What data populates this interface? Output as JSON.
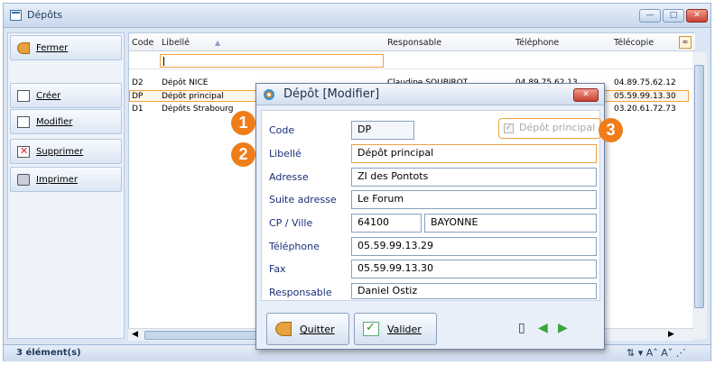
{
  "window": {
    "title": "Dépôts",
    "minimize": "—",
    "maximize": "□",
    "close": "✕"
  },
  "sidebar": {
    "items": [
      {
        "label": "Fermer",
        "icon": "exit-door-icon"
      },
      {
        "label": "Créer",
        "icon": "new-document-icon"
      },
      {
        "label": "Modifier",
        "icon": "edit-document-icon"
      },
      {
        "label": "Supprimer",
        "icon": "delete-icon"
      },
      {
        "label": "Imprimer",
        "icon": "printer-icon"
      }
    ]
  },
  "grid": {
    "columns": [
      "Code",
      "Libellé",
      "Responsable",
      "Téléphone",
      "Télécopie"
    ],
    "sort_indicator": "▲",
    "rows": [
      {
        "code": "D2",
        "libelle": "Dépôt NICE",
        "responsable": "Claudine SOUBIROT",
        "telephone": "04.89.75.62.13",
        "telecopie": "04.89.75.62.12"
      },
      {
        "code": "DP",
        "libelle": "Dépôt principal",
        "responsable": "",
        "telephone": "",
        "telecopie": "05.59.99.13.30"
      },
      {
        "code": "D1",
        "libelle": "Dépôts Strabourg",
        "responsable": "",
        "telephone": "",
        "telecopie": "03.20.61.72.73"
      }
    ]
  },
  "status": {
    "count": "3 élément(s)",
    "tools": "⇅ ▾ A˄ A˅ ⋰"
  },
  "dialog": {
    "title": "Dépôt [Modifier]",
    "close": "✕",
    "fields": {
      "code_label": "Code",
      "code_value": "DP",
      "principal_label": "Dépôt principal",
      "principal_check": "✓",
      "libelle_label": "Libellé",
      "libelle_value": "Dépôt principal",
      "adresse_label": "Adresse",
      "adresse_value": "ZI des Pontots",
      "suite_label": "Suite adresse",
      "suite_value": "Le Forum",
      "cpville_label": "CP / Ville",
      "cp_value": "64100",
      "ville_value": "BAYONNE",
      "tel_label": "Téléphone",
      "tel_value": "05.59.99.13.29",
      "fax_label": "Fax",
      "fax_value": "05.59.99.13.30",
      "resp_label": "Responsable",
      "resp_value": "Daniel Ostiz"
    },
    "buttons": {
      "quit": "Quitter",
      "validate": "Valider"
    },
    "nav": {
      "doc": "▯",
      "prev": "◀",
      "next": "▶"
    }
  },
  "callouts": [
    "1",
    "2",
    "3"
  ],
  "colors": {
    "accent": "#ee7d1a",
    "highlight": "#f0a040",
    "label_blue": "#1a2f7a"
  }
}
